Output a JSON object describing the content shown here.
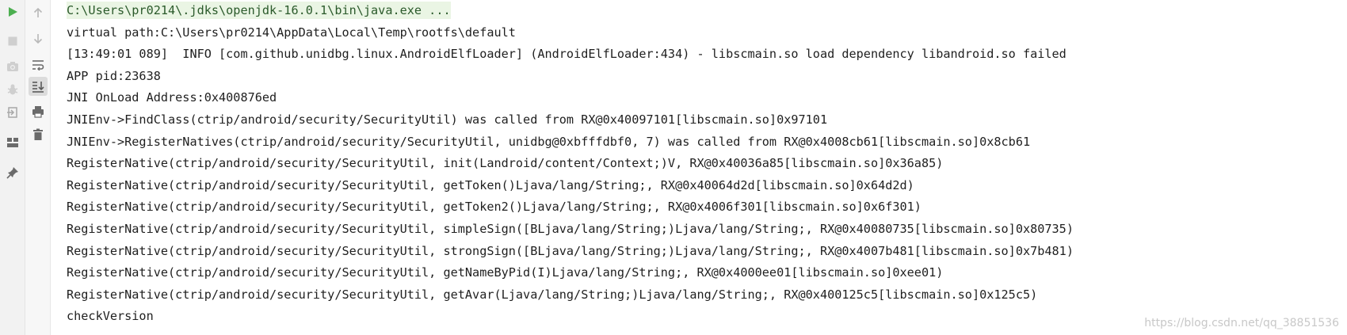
{
  "toolbar": {
    "left": [
      {
        "name": "run-icon",
        "color": "#4caf50"
      },
      {
        "name": "stop-icon",
        "color": "#c8c8c8"
      },
      {
        "name": "camera-icon",
        "color": "#c8c8c8"
      },
      {
        "name": "debug-bug-icon",
        "color": "#c8c8c8"
      },
      {
        "name": "exit-icon",
        "color": "#a0a0a0"
      },
      {
        "name": "layout-icon",
        "color": "#6b6b6b"
      },
      {
        "name": "pin-icon",
        "color": "#6b6b6b"
      }
    ],
    "right": [
      {
        "name": "arrow-up-icon"
      },
      {
        "name": "arrow-down-icon"
      },
      {
        "name": "soft-wrap-icon"
      },
      {
        "name": "scroll-to-end-icon",
        "active": true
      },
      {
        "name": "print-icon"
      },
      {
        "name": "trash-icon"
      }
    ]
  },
  "console": {
    "lines": [
      "C:\\Users\\pr0214\\.jdks\\openjdk-16.0.1\\bin\\java.exe ...",
      "virtual path:C:\\Users\\pr0214\\AppData\\Local\\Temp\\rootfs\\default",
      "[13:49:01 089]  INFO [com.github.unidbg.linux.AndroidElfLoader] (AndroidElfLoader:434) - libscmain.so load dependency libandroid.so failed",
      "APP pid:23638",
      "JNI OnLoad Address:0x400876ed",
      "JNIEnv->FindClass(ctrip/android/security/SecurityUtil) was called from RX@0x40097101[libscmain.so]0x97101",
      "JNIEnv->RegisterNatives(ctrip/android/security/SecurityUtil, unidbg@0xbfffdbf0, 7) was called from RX@0x4008cb61[libscmain.so]0x8cb61",
      "RegisterNative(ctrip/android/security/SecurityUtil, init(Landroid/content/Context;)V, RX@0x40036a85[libscmain.so]0x36a85)",
      "RegisterNative(ctrip/android/security/SecurityUtil, getToken()Ljava/lang/String;, RX@0x40064d2d[libscmain.so]0x64d2d)",
      "RegisterNative(ctrip/android/security/SecurityUtil, getToken2()Ljava/lang/String;, RX@0x4006f301[libscmain.so]0x6f301)",
      "RegisterNative(ctrip/android/security/SecurityUtil, simpleSign([BLjava/lang/String;)Ljava/lang/String;, RX@0x40080735[libscmain.so]0x80735)",
      "RegisterNative(ctrip/android/security/SecurityUtil, strongSign([BLjava/lang/String;)Ljava/lang/String;, RX@0x4007b481[libscmain.so]0x7b481)",
      "RegisterNative(ctrip/android/security/SecurityUtil, getNameByPid(I)Ljava/lang/String;, RX@0x4000ee01[libscmain.so]0xee01)",
      "RegisterNative(ctrip/android/security/SecurityUtil, getAvar(Ljava/lang/String;)Ljava/lang/String;, RX@0x400125c5[libscmain.so]0x125c5)",
      "checkVersion"
    ]
  },
  "watermark": "https://blog.csdn.net/qq_38851536"
}
